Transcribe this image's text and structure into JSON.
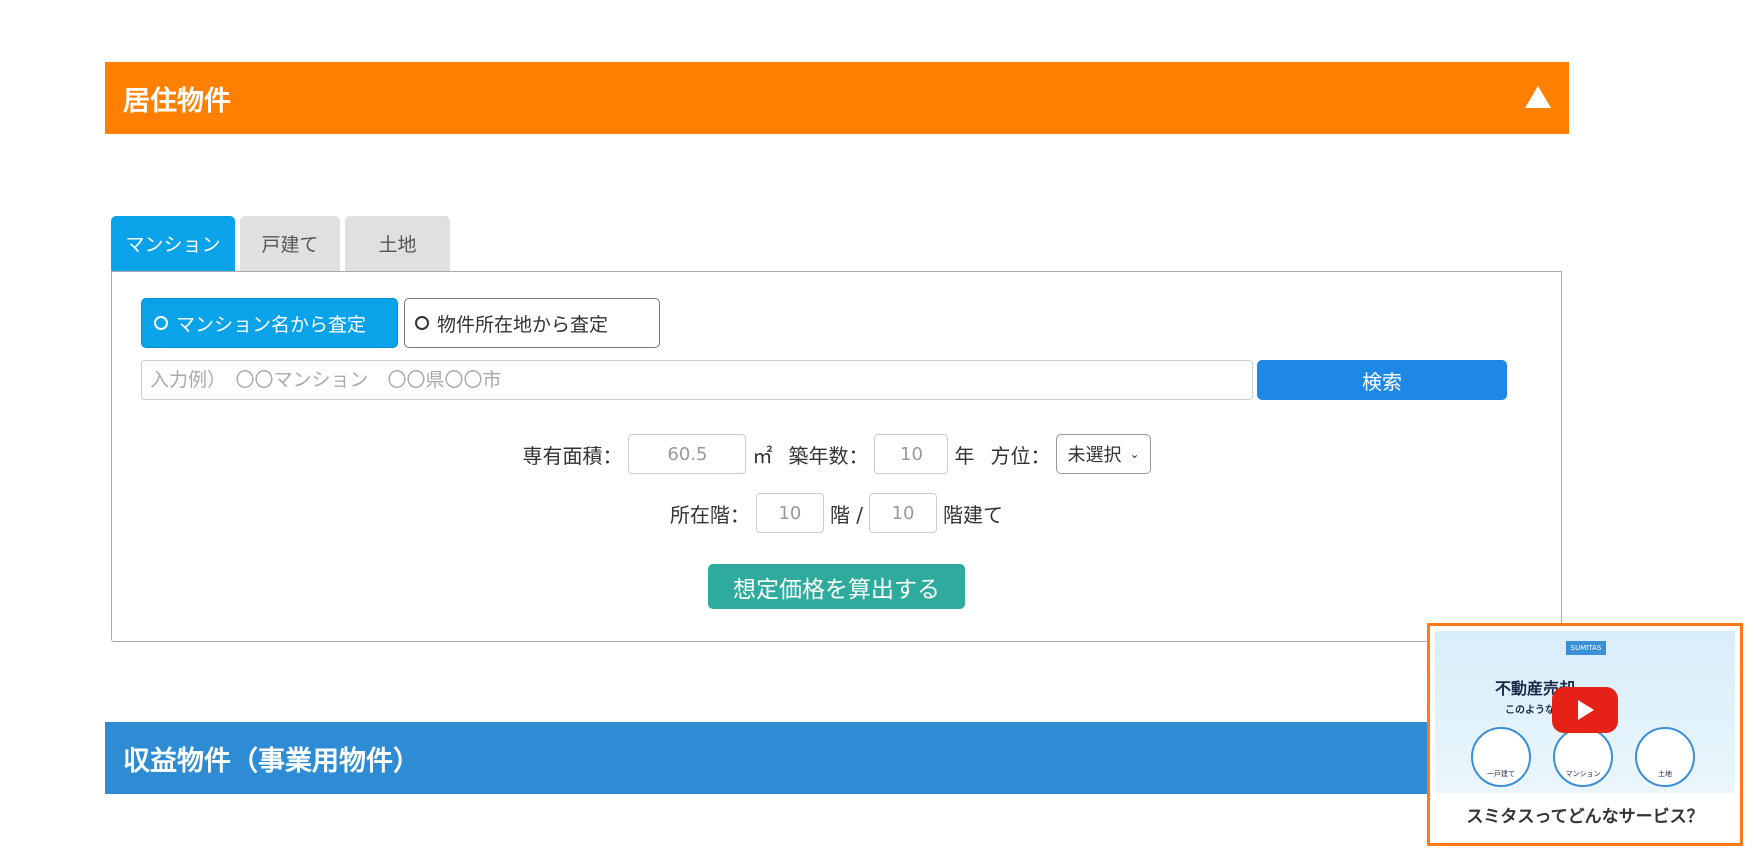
{
  "sections": {
    "residential_title": "居住物件",
    "income_title": "収益物件（事業用物件）"
  },
  "tabs": [
    {
      "label": "マンション",
      "active": true
    },
    {
      "label": "戸建て",
      "active": false
    },
    {
      "label": "土地",
      "active": false
    }
  ],
  "mode": {
    "by_name": "マンション名から査定",
    "by_location": "物件所在地から査定",
    "selected": "by_name"
  },
  "search": {
    "placeholder": "入力例）　〇〇マンション　〇〇県〇〇市",
    "button_label": "検索"
  },
  "form": {
    "area_label": "専有面積：",
    "area_value": "60.5",
    "area_unit": "㎡",
    "age_label": "築年数：",
    "age_value": "10",
    "age_unit": "年",
    "direction_label": "方位：",
    "direction_value": "未選択",
    "floor_label": "所在階：",
    "floor_value": "10",
    "floor_unit": "階 /",
    "total_floors_value": "10",
    "total_floors_unit": "階建て",
    "calculate_label": "想定価格を算出する"
  },
  "video": {
    "badge": "SUMITAS",
    "headline": "不動産売却",
    "subline": "このような",
    "circles": [
      "一戸建て",
      "マンション",
      "土地"
    ],
    "caption": "スミタスってどんなサービス？"
  },
  "colors": {
    "residential_bar": "#ff8000",
    "income_bar": "#2d8cd4",
    "tab_active": "#0aa2e8",
    "search_button": "#1e88e5",
    "calculate_button": "#2eab9d",
    "video_border": "#ff7a14"
  }
}
